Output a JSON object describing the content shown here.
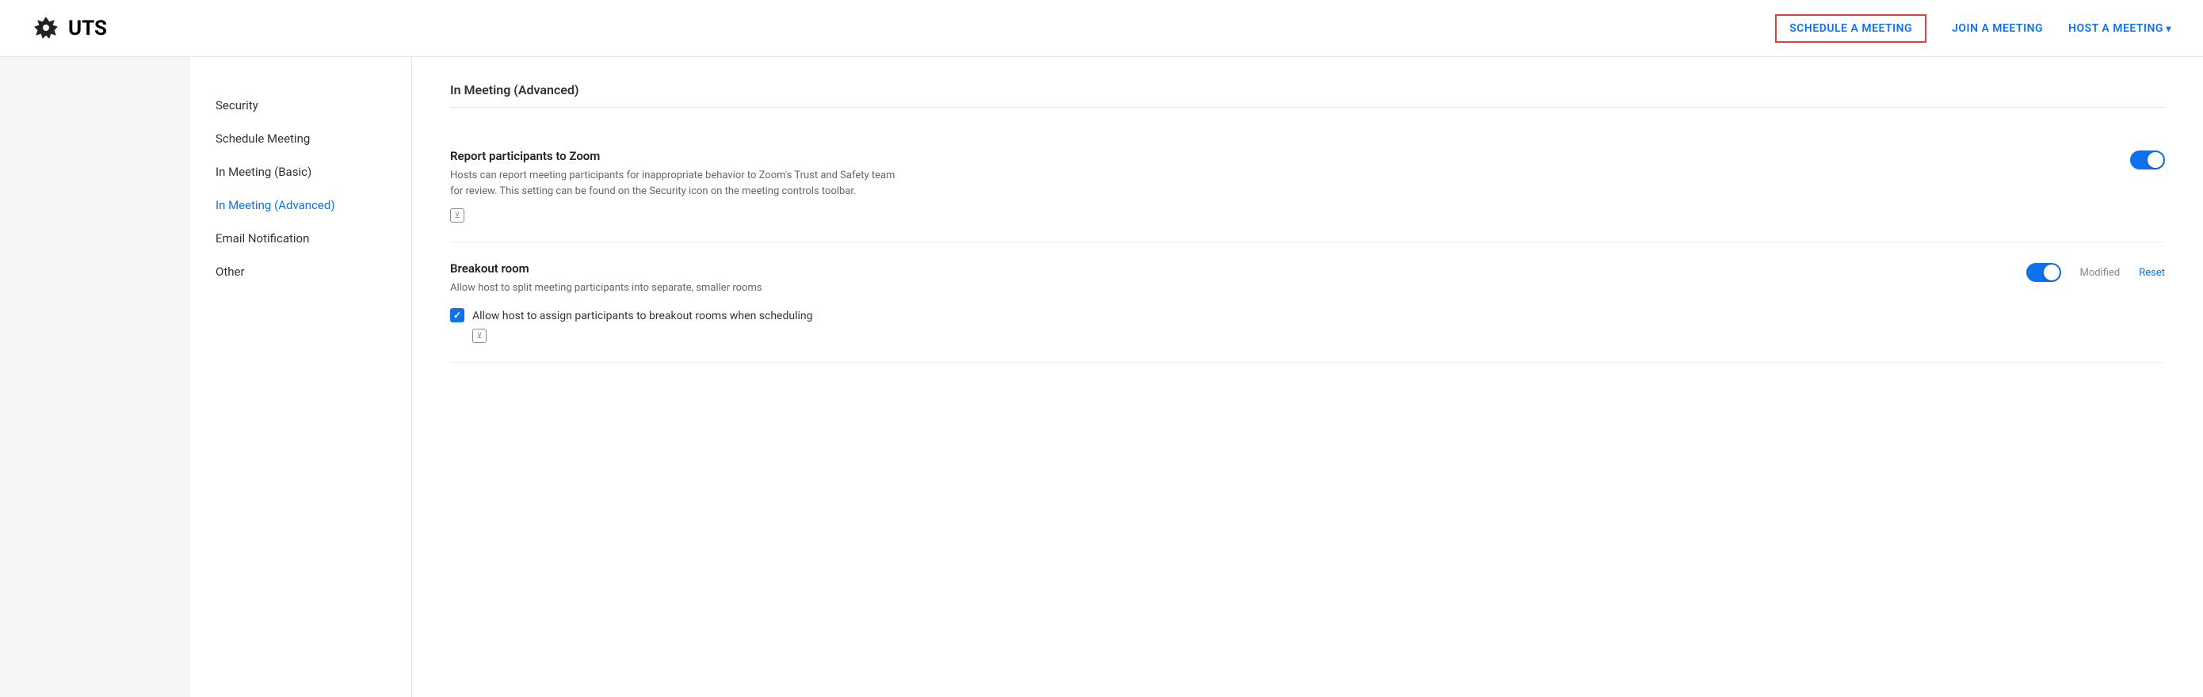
{
  "header": {
    "logo_text": "UTS",
    "nav": {
      "schedule": "SCHEDULE A MEETING",
      "join": "JOIN A MEETING",
      "host": "HOST A MEETING"
    }
  },
  "sidebar_nav": {
    "items": [
      {
        "label": "Security",
        "active": false
      },
      {
        "label": "Schedule Meeting",
        "active": false
      },
      {
        "label": "In Meeting (Basic)",
        "active": false
      },
      {
        "label": "In Meeting (Advanced)",
        "active": true
      },
      {
        "label": "Email Notification",
        "active": false
      },
      {
        "label": "Other",
        "active": false
      }
    ]
  },
  "content": {
    "section_title": "In Meeting (Advanced)",
    "settings": [
      {
        "id": "report-participants",
        "title": "Report participants to Zoom",
        "description": "Hosts can report meeting participants for inappropriate behavior to Zoom's Trust and Safety team for review. This setting can be found on the Security icon on the meeting controls toolbar.",
        "toggle_on": true,
        "show_modified": false,
        "show_reset": false,
        "has_info_icon": true,
        "info_icon_label": "ⓥ",
        "sub_options": []
      },
      {
        "id": "breakout-room",
        "title": "Breakout room",
        "description": "Allow host to split meeting participants into separate, smaller rooms",
        "toggle_on": true,
        "show_modified": true,
        "show_reset": true,
        "modified_label": "Modified",
        "reset_label": "Reset",
        "has_info_icon": false,
        "sub_options": [
          {
            "id": "assign-participants",
            "label": "Allow host to assign participants to breakout rooms when scheduling",
            "checked": true,
            "has_info_icon": true,
            "info_icon_label": "ⓥ"
          }
        ]
      }
    ]
  }
}
